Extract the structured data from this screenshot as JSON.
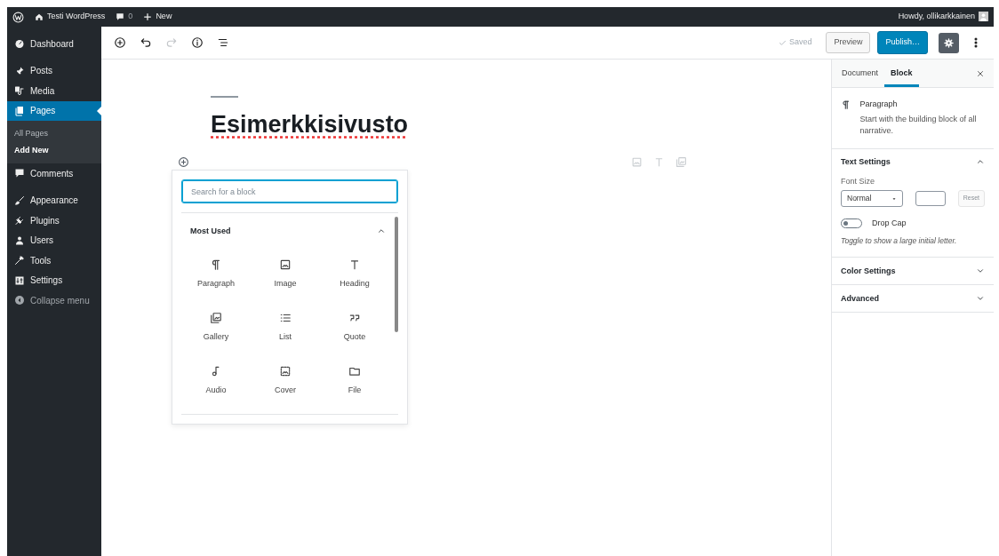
{
  "admin_bar": {
    "site_name": "Testi WordPress",
    "comments_count": "0",
    "new_label": "New",
    "greeting": "Howdy, ollikarkkainen"
  },
  "sidebar": {
    "groups": [
      {
        "items": [
          {
            "label": "Dashboard",
            "kind": "dashboard",
            "selected": false
          }
        ]
      },
      {
        "items": [
          {
            "label": "Posts",
            "kind": "posts",
            "selected": false
          },
          {
            "label": "Media",
            "kind": "media",
            "selected": false
          },
          {
            "label": "Pages",
            "kind": "pages",
            "selected": true,
            "children": [
              {
                "label": "All Pages",
                "selected": false
              },
              {
                "label": "Add New",
                "selected": true
              }
            ]
          },
          {
            "label": "Comments",
            "kind": "comments",
            "selected": false
          }
        ]
      },
      {
        "items": [
          {
            "label": "Appearance",
            "kind": "appearance",
            "selected": false
          },
          {
            "label": "Plugins",
            "kind": "plugins",
            "selected": false
          },
          {
            "label": "Users",
            "kind": "users",
            "selected": false
          },
          {
            "label": "Tools",
            "kind": "tools",
            "selected": false
          },
          {
            "label": "Settings",
            "kind": "settings",
            "selected": false
          }
        ]
      }
    ],
    "collapse": "Collapse menu"
  },
  "toolbar": {
    "history": [
      {
        "kind": "undo",
        "disabled": false
      },
      {
        "kind": "redo",
        "disabled": true
      }
    ],
    "saved": "Saved",
    "preview": "Preview",
    "publish": "Publish…",
    "settings_selected": true
  },
  "editor": {
    "title": "Esimerkkisivusto"
  },
  "inserter": {
    "placeholder": "Search for a block",
    "section": {
      "title": "Most Used",
      "expanded": true
    },
    "blocks": [
      {
        "label": "Paragraph",
        "kind": "paragraph"
      },
      {
        "label": "Image",
        "kind": "image"
      },
      {
        "label": "Heading",
        "kind": "heading"
      },
      {
        "label": "Gallery",
        "kind": "gallery"
      },
      {
        "label": "List",
        "kind": "list"
      },
      {
        "label": "Quote",
        "kind": "quote"
      },
      {
        "label": "Audio",
        "kind": "audio"
      },
      {
        "label": "Cover",
        "kind": "cover"
      },
      {
        "label": "File",
        "kind": "file"
      }
    ]
  },
  "settings_sidebar": {
    "tabs": [
      {
        "label": "Document",
        "selected": false
      },
      {
        "label": "Block",
        "selected": true
      }
    ],
    "block_card": {
      "name": "Paragraph",
      "description": "Start with the building block of all narrative."
    },
    "panels": [
      {
        "title": "Text Settings",
        "expanded": true,
        "font_size_label": "Font Size",
        "font_size": "Normal",
        "reset": "Reset",
        "reset_disabled": true,
        "drop_cap": {
          "label": "Drop Cap",
          "on": false,
          "help": "Toggle to show a large initial letter."
        }
      },
      {
        "title": "Color Settings",
        "expanded": false
      },
      {
        "title": "Advanced",
        "expanded": false
      }
    ]
  }
}
